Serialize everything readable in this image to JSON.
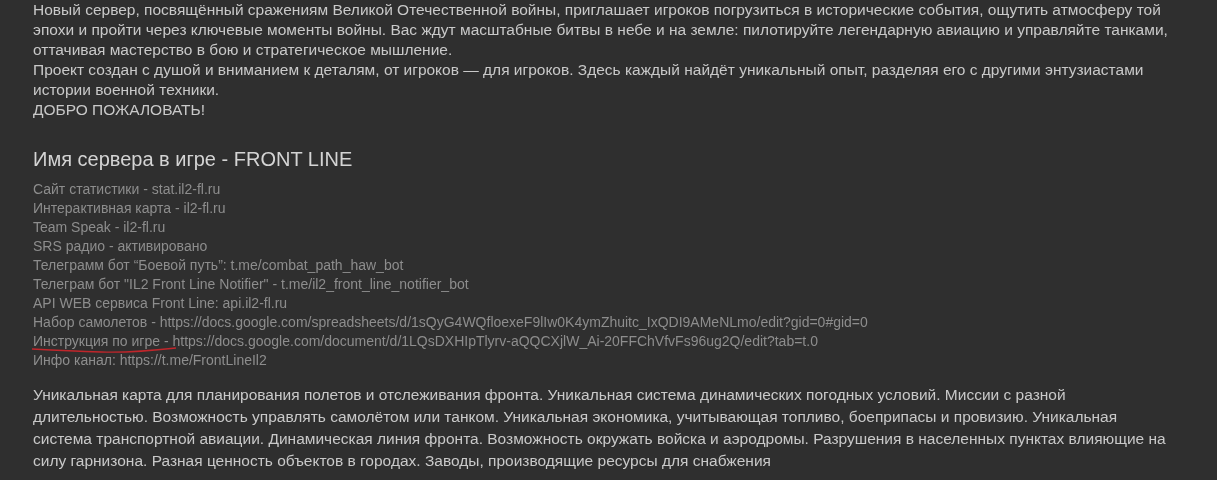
{
  "intro_paragraphs": [
    "Новый сервер, посвящённый сражениям Великой Отечественной войны, приглашает игроков погрузиться в исторические события, ощутить атмосферу той эпохи и пройти через ключевые моменты войны. Вас ждут масштабные битвы в небе и на земле: пилотируйте легендарную авиацию и управляйте танками, оттачивая мастерство в бою и стратегическое мышление.",
    "Проект создан с душой и вниманием к деталям, от игроков — для игроков. Здесь каждый найдёт уникальный опыт, разделяя его с другими энтузиастами истории военной техники.",
    "ДОБРО ПОЖАЛОВАТЬ!"
  ],
  "heading": "Имя сервера в игре - FRONT LINE",
  "info_lines": [
    {
      "text": "Сайт статистики - stat.il2-fl.ru",
      "underlined": false
    },
    {
      "text": "Интерактивная карта - il2-fl.ru",
      "underlined": false
    },
    {
      "text": "Team Speak - il2-fl.ru",
      "underlined": false
    },
    {
      "text": "SRS радио - активировано",
      "underlined": false
    },
    {
      "text": "Телеграмм бот “Боевой путь”: t.me/combat_path_haw_bot",
      "underlined": false
    },
    {
      "text": "Телеграм бот \"IL2 Front Line Notifier\" - t.me/il2_front_line_notifier_bot",
      "underlined": false
    },
    {
      "text": "API WEB сервиса Front Line: api.il2-fl.ru",
      "underlined": false
    },
    {
      "text": "Набор самолетов - https://docs.google.com/spreadsheets/d/1sQyG4WQfloexeF9lIw0K4ymZhuitc_IxQDI9AMeNLmo/edit?gid=0#gid=0",
      "underlined": false
    },
    {
      "text": "Инструкция по игре - https://docs.google.com/document/d/1LQsDXHIpTlyrv-aQQCXjlW_Ai-20FFChVfvFs96ug2Q/edit?tab=t.0",
      "underlined": true
    },
    {
      "text": "Инфо канал: https://t.me/FrontLineIl2",
      "underlined": false
    }
  ],
  "features_paragraph": "Уникальная карта для планирования полетов и отслеживания фронта. Уникальная система динамических погодных условий. Миссии с разной длительностью. Возможность управлять самолётом или танком. Уникальная экономика, учитывающая топливо, боеприпасы и провизию. Уникальная система транспортной авиации. Динамическая линия фронта. Возможность окружать войска и аэродромы. Разрушения в населенных пунктах влияющие на силу гарнизона. Разная ценность объектов в городах. Заводы, производящие ресурсы для снабжения"
}
